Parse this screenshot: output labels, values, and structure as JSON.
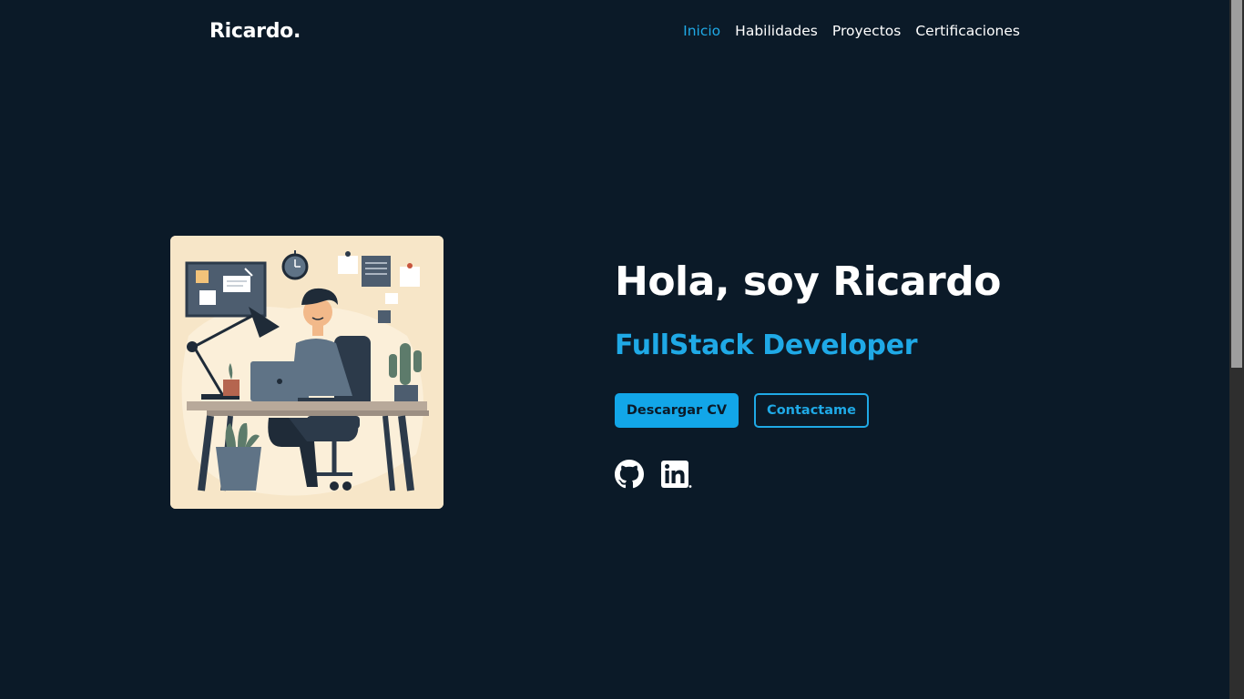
{
  "header": {
    "logo": "Ricardo.",
    "nav": [
      {
        "label": "Inicio",
        "active": true
      },
      {
        "label": "Habilidades",
        "active": false
      },
      {
        "label": "Proyectos",
        "active": false
      },
      {
        "label": "Certificaciones",
        "active": false
      }
    ]
  },
  "hero": {
    "title": "Hola, soy Ricardo",
    "subtitle": "FullStack Developer",
    "primary_button": "Descargar CV",
    "secondary_button": "Contactame",
    "social": [
      {
        "icon": "github-icon"
      },
      {
        "icon": "linkedin-icon"
      }
    ]
  },
  "colors": {
    "background": "#0b1a28",
    "accent": "#1fa9e6",
    "text": "#ffffff",
    "illustration_background": "#f7e6c8"
  }
}
